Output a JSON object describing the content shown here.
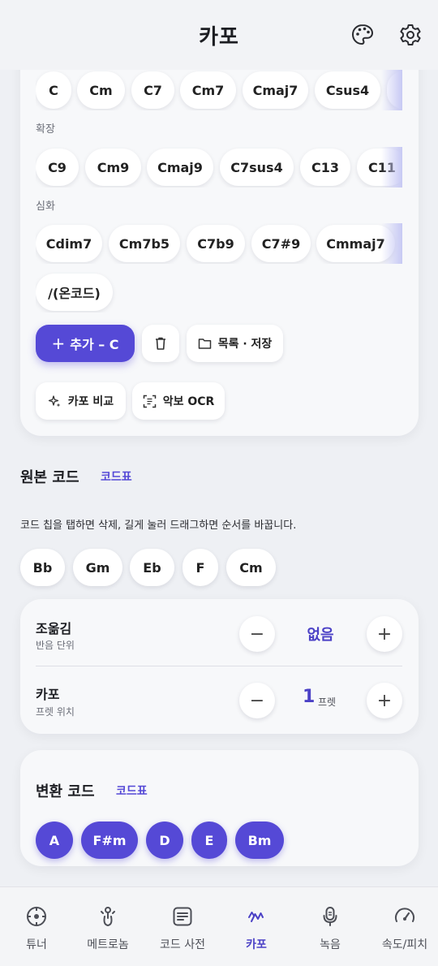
{
  "header": {
    "title": "카포",
    "palette_icon": "palette-icon",
    "settings_icon": "gear-icon"
  },
  "chords": {
    "basic": [
      "C",
      "Cm",
      "C7",
      "Cm7",
      "Cmaj7",
      "Csus4"
    ],
    "extended_label": "확장",
    "extended": [
      "C9",
      "Cm9",
      "Cmaj9",
      "C7sus4",
      "C13",
      "C11"
    ],
    "advanced_label": "심화",
    "advanced": [
      "Cdim7",
      "Cm7b5",
      "C7b9",
      "C7#9",
      "Cmmaj7"
    ],
    "slash": "/(온코드)"
  },
  "actions": {
    "add_label": "추가 – C",
    "list_save_label": "목록 · 저장",
    "capo_compare_label": "카포 비교",
    "ocr_label": "악보 OCR"
  },
  "original": {
    "title": "원본 코드",
    "chart_link": "코드표",
    "help": "코드 칩을 탭하면 삭제, 길게 눌러 드래그하면 순서를 바꿉니다.",
    "chords": [
      "Bb",
      "Gm",
      "Eb",
      "F",
      "Cm"
    ]
  },
  "settings": {
    "transpose_label": "조옮김",
    "transpose_sub": "반음 단위",
    "transpose_value": "없음",
    "capo_label": "카포",
    "capo_sub": "프렛 위치",
    "capo_value": "1",
    "capo_unit": "프렛",
    "minus": "−",
    "plus": "+"
  },
  "result": {
    "title": "변환 코드",
    "chart_link": "코드표",
    "chords": [
      "A",
      "F#m",
      "D",
      "E",
      "Bm"
    ]
  },
  "nav": {
    "items": [
      "튜너",
      "메트로놈",
      "코드 사전",
      "카포",
      "녹음",
      "속도/피치"
    ],
    "active": "카포"
  },
  "colors": {
    "accent": "#5549d6",
    "background": "#eef0f4",
    "card": "#f7f8fa"
  }
}
